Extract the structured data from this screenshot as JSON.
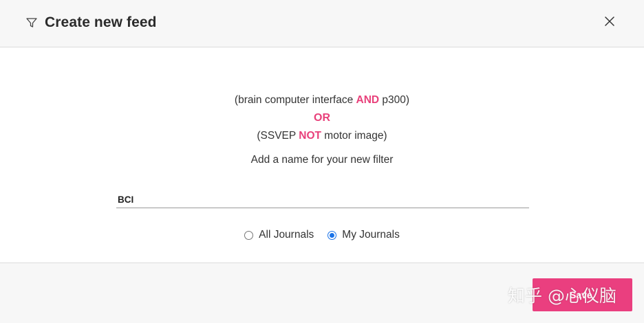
{
  "dialog": {
    "title": "Create new feed",
    "close_icon": "close-icon",
    "filter_icon": "filter-icon"
  },
  "query": {
    "line1": {
      "before": "(brain computer interface ",
      "keyword": "AND",
      "after": " p300)"
    },
    "operator": "OR",
    "line3": {
      "before": "(SSVEP ",
      "keyword": "NOT",
      "after": " motor image)"
    }
  },
  "form": {
    "prompt": "Add a name for your new filter",
    "name_value": "BCI",
    "options": [
      {
        "label": "All Journals",
        "checked": false
      },
      {
        "label": "My Journals",
        "checked": true
      }
    ]
  },
  "footer": {
    "save_label": "Save"
  },
  "watermark": "知乎 @心仪脑",
  "colors": {
    "accent": "#ea3f7f",
    "keyword": "#e8407a",
    "radio_checked": "#1a73e8"
  }
}
